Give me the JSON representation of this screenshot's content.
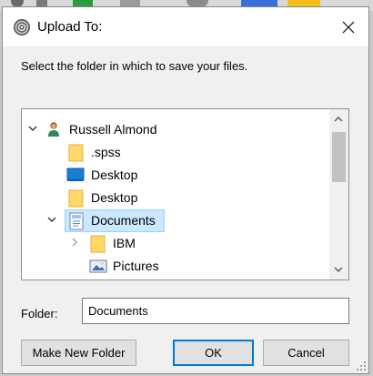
{
  "dialog": {
    "title": "Upload To:",
    "prompt": "Select the folder in which to save your files.",
    "close_glyph": "✕"
  },
  "tree": {
    "items": [
      {
        "label": "Russell Almond",
        "icon": "user-icon",
        "expander": "expanded"
      },
      {
        "label": ".spss",
        "icon": "folder-icon"
      },
      {
        "label": "Desktop",
        "icon": "desktop-icon"
      },
      {
        "label": "Desktop",
        "icon": "folder-icon"
      },
      {
        "label": "Documents",
        "icon": "documents-icon",
        "expander": "expanded",
        "selected": true
      },
      {
        "label": "IBM",
        "icon": "folder-icon",
        "expander": "collapsed"
      },
      {
        "label": "Pictures",
        "icon": "pictures-icon"
      }
    ]
  },
  "folder": {
    "label": "Folder:",
    "value": "Documents"
  },
  "buttons": {
    "new_folder": "Make New Folder",
    "ok": "OK",
    "cancel": "Cancel"
  },
  "colors": {
    "selection": "#cce8ff",
    "selection_border": "#99d1ff",
    "accent": "#0078d7",
    "folder": "#ffd868"
  }
}
